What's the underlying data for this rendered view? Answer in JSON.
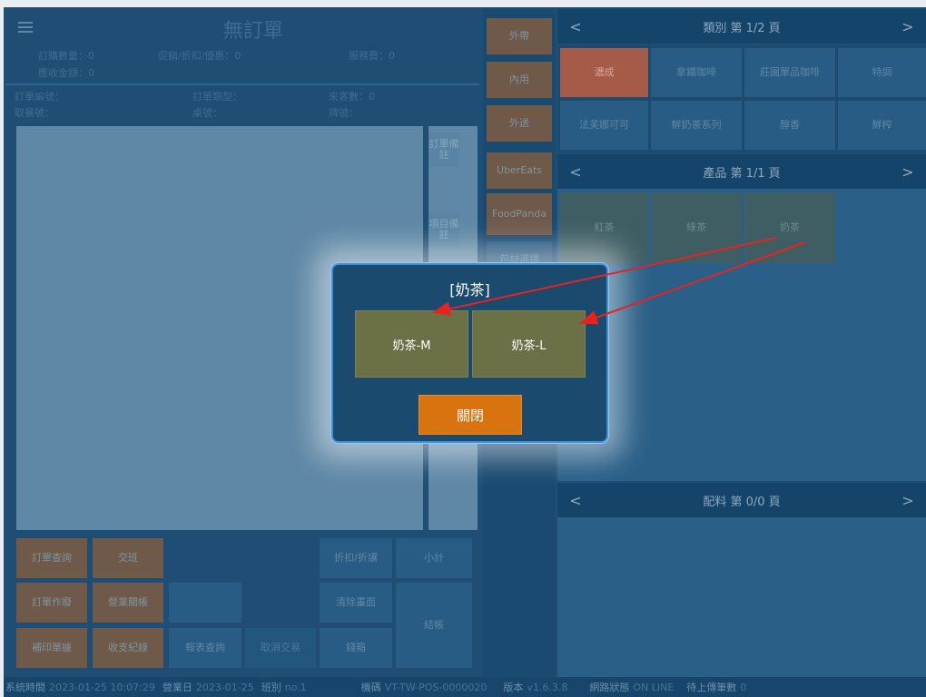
{
  "order": {
    "title": "無訂單",
    "menu_icon": "hamburger-icon",
    "purchase_qty": "訂購數量：0",
    "promo": "促銷/折扣/優惠：0",
    "service_fee": "服務費：0",
    "receivable": "應收金額：0",
    "order_no": "訂單編號：",
    "order_type": "訂單類型：",
    "guests": "來客數：0",
    "pickup_no": "取餐號：",
    "table_no": "桌號：",
    "tag_no": "牌號："
  },
  "side_buttons": {
    "order_note": "訂單備註",
    "item_note": "項目備註"
  },
  "order_types": [
    "外帶",
    "內用",
    "外送",
    "UberEats",
    "FoodPanda",
    "包材選擇"
  ],
  "bottom_buttons": {
    "order_query": "訂單查詢",
    "shift": "交班",
    "discount": "折扣/折讓",
    "subtotal": "小計",
    "order_ops": "訂單作廢",
    "close_business": "營業關帳",
    "clear_screen": "清除畫面",
    "checkout": "結帳",
    "reprint": "補印單據",
    "cash_record": "收支紀錄",
    "report_query": "報表查詢",
    "cancel_trade": "取消交易",
    "cash_box": "錢箱"
  },
  "categories": {
    "title": "類別 第 1/2 頁",
    "items": [
      "濃成",
      "拿鐵咖啡",
      "莊園單品咖啡",
      "特調",
      "法芙娜可可",
      "鮮奶茶系列",
      "醇香",
      "鮮榨"
    ],
    "active_color": "#a65a48"
  },
  "products": {
    "title": "產品 第 1/1 頁",
    "items": [
      "紅茶",
      "綠茶",
      "奶茶"
    ]
  },
  "toppings": {
    "title": "配料 第 0/0 頁"
  },
  "nav": {
    "prev": "<",
    "next": ">"
  },
  "modal": {
    "title": "[奶茶]",
    "options": [
      "奶茶-M",
      "奶茶-L"
    ],
    "close_label": "關閉",
    "option_color": "#6c7046",
    "close_color": "#d8730f"
  },
  "status_bar": {
    "sys_time_label": "系統時間",
    "sys_time": "2023-01-25 10:07:29",
    "biz_day_label": "營業日",
    "biz_day": "2023-01-25",
    "shift_label": "班別",
    "shift": "no.1",
    "machine_label": "機碼",
    "machine": "VT-TW-POS-0000020",
    "version_label": "版本",
    "version": "v1.6.3.8",
    "network_label": "網路狀態",
    "network": "ON LINE",
    "pending_label": "待上傳筆數",
    "pending": "0"
  }
}
